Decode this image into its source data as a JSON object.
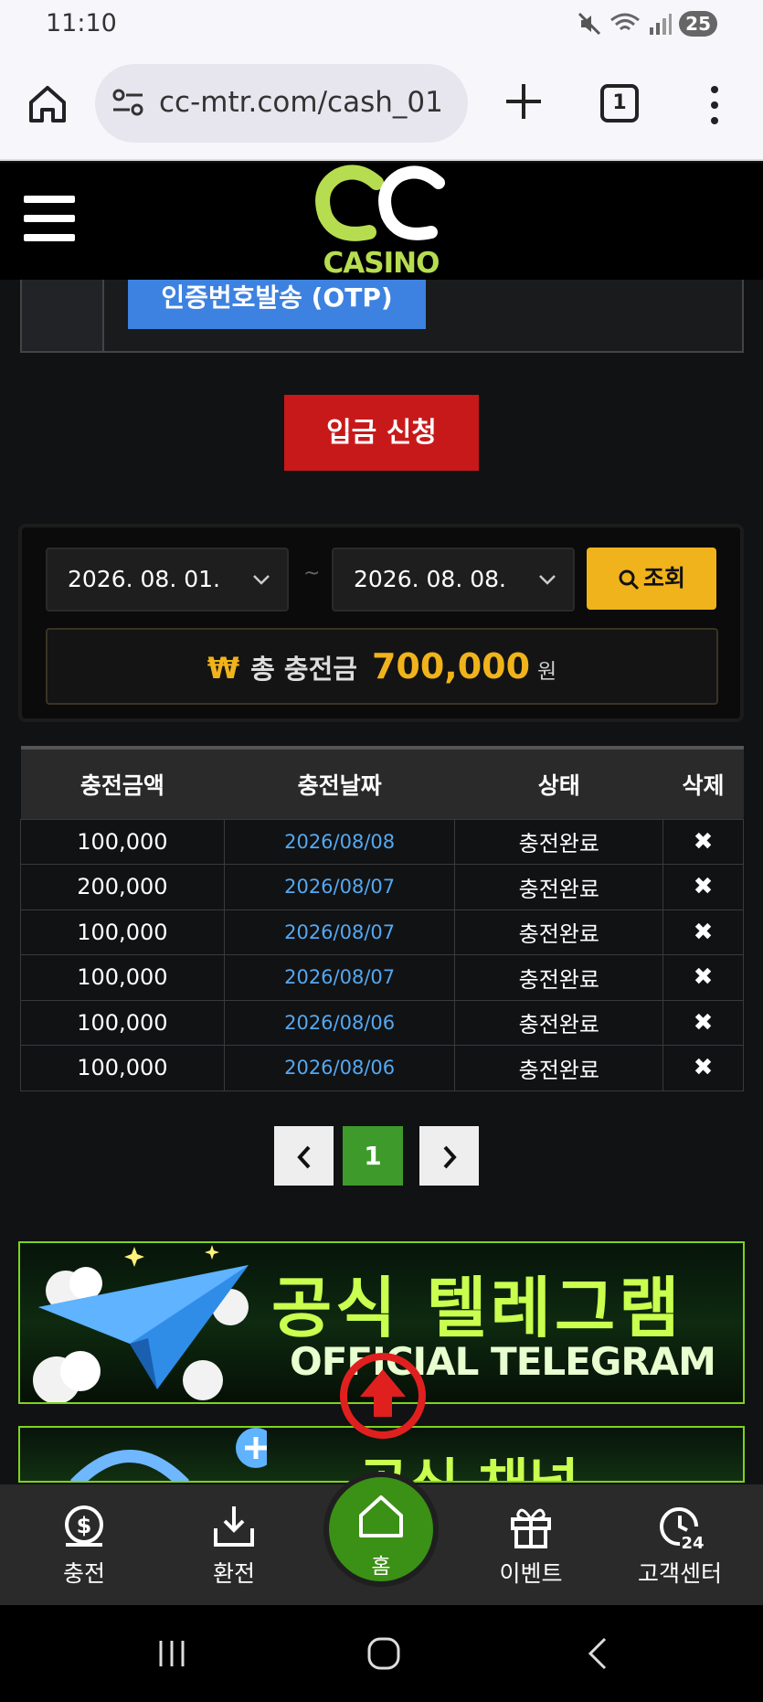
{
  "status_bar": {
    "time": "11:10",
    "battery": "25"
  },
  "browser": {
    "url": "cc-mtr.com/cash_01",
    "tab_count": "1"
  },
  "site": {
    "logo_text": "CASINO"
  },
  "otp": {
    "button_label": "인증번호발송 (OTP)"
  },
  "deposit": {
    "button_label": "입금 신청"
  },
  "search": {
    "start_date": "2026. 08. 01.",
    "separator": "~",
    "end_date": "2026. 08. 08.",
    "button_label": "조회"
  },
  "total": {
    "symbol": "₩",
    "label": "총 충전금",
    "amount": "700,000",
    "unit": "원"
  },
  "table": {
    "headers": [
      "충전금액",
      "충전날짜",
      "상태",
      "삭제"
    ],
    "rows": [
      {
        "amount": "100,000",
        "date": "2026/08/08",
        "status": "충전완료",
        "delete": "✖"
      },
      {
        "amount": "200,000",
        "date": "2026/08/07",
        "status": "충전완료",
        "delete": "✖"
      },
      {
        "amount": "100,000",
        "date": "2026/08/07",
        "status": "충전완료",
        "delete": "✖"
      },
      {
        "amount": "100,000",
        "date": "2026/08/07",
        "status": "충전완료",
        "delete": "✖"
      },
      {
        "amount": "100,000",
        "date": "2026/08/06",
        "status": "충전완료",
        "delete": "✖"
      },
      {
        "amount": "100,000",
        "date": "2026/08/06",
        "status": "충전완료",
        "delete": "✖"
      }
    ]
  },
  "pagination": {
    "current_page": "1"
  },
  "banners": {
    "telegram_title": "공식 텔레그램",
    "telegram_subtitle": "OFFICIAL TELEGRAM",
    "channel_title": "공식 채널"
  },
  "bottom_nav": {
    "charge": "충전",
    "withdraw": "환전",
    "home": "홈",
    "event": "이벤트",
    "support": "고객센터"
  }
}
